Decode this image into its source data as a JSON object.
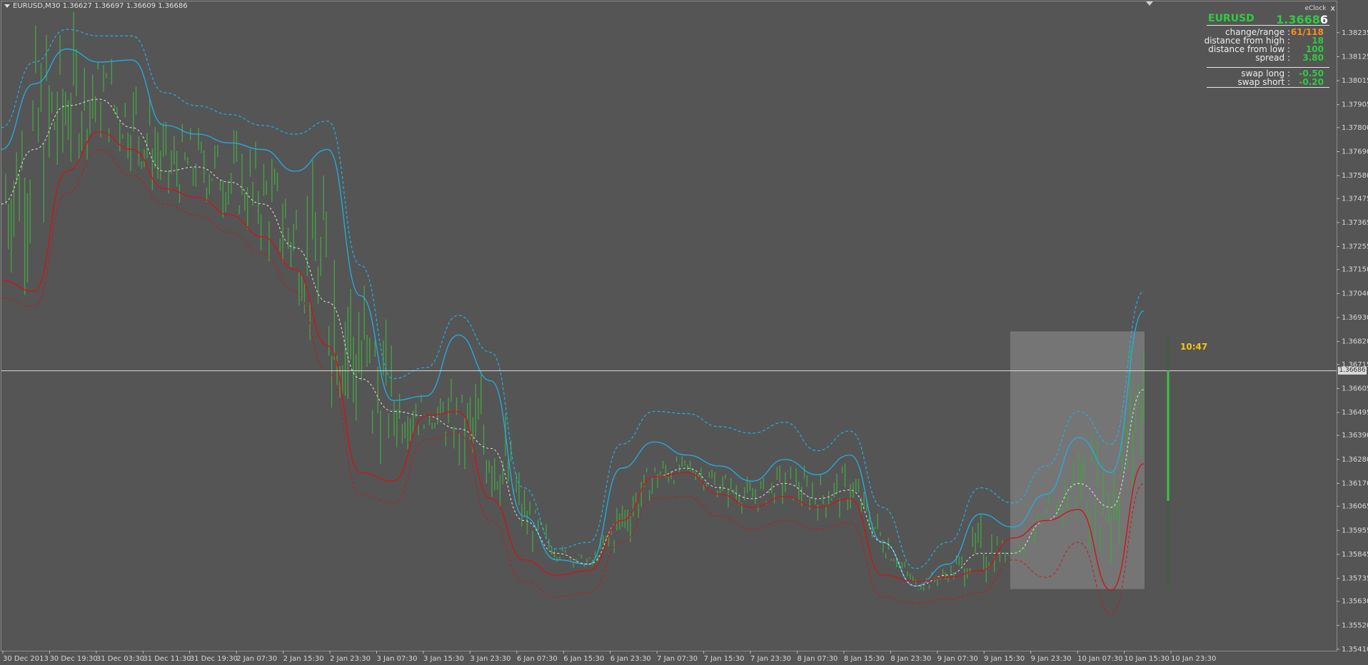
{
  "window": {
    "symbol_info": "EURUSD,M30  1.36627 1.36697 1.36609 1.36686"
  },
  "eclock": {
    "title": "eClock",
    "close": "x",
    "symbol": "EURUSD",
    "price_main": "1.3668",
    "price_last_digit": "6",
    "rows_top": [
      {
        "label": "change/range :",
        "value": "61/118",
        "color": "#ff8c1a"
      },
      {
        "label": "distance from high :",
        "value": "18",
        "color": "#2ecc40"
      },
      {
        "label": "distance from low :",
        "value": "100",
        "color": "#2ecc40"
      },
      {
        "label": "spread :",
        "value": "3.80",
        "color": "#2ecc40"
      }
    ],
    "rows_bottom": [
      {
        "label": "swap long :",
        "value": "-0.50",
        "color": "#2ecc40"
      },
      {
        "label": "swap short :",
        "value": "-0.20",
        "color": "#2ecc40"
      }
    ]
  },
  "timer": "10:47",
  "current_price_tag": "1.36686",
  "colors": {
    "background": "#555555",
    "candle": "#46a046",
    "upper_band": "#1fb0e6",
    "lower_band": "#c8171b",
    "mid_line": "#e6e6e6",
    "session_box": "#777777",
    "price_line": "#d9d9d9"
  },
  "chart_data": {
    "type": "line",
    "symbol": "EURUSD",
    "timeframe": "M30",
    "ohlc_last": {
      "open": 1.36627,
      "high": 1.36697,
      "low": 1.36609,
      "close": 1.36686
    },
    "ylim": [
      1.3541,
      1.3828
    ],
    "y_ticks": [
      "1.38235",
      "1.38125",
      "1.38015",
      "1.37905",
      "1.37800",
      "1.37690",
      "1.37580",
      "1.37475",
      "1.37365",
      "1.37255",
      "1.37150",
      "1.37040",
      "1.36930",
      "1.36820",
      "1.36715",
      "1.36605",
      "1.36495",
      "1.36390",
      "1.36280",
      "1.36170",
      "1.36065",
      "1.35955",
      "1.35845",
      "1.35735",
      "1.35630",
      "1.35520",
      "1.35410"
    ],
    "x_ticks": [
      "30 Dec 2013",
      "30 Dec 19:30",
      "31 Dec 03:30",
      "31 Dec 11:30",
      "31 Dec 19:30",
      "2 Jan 07:30",
      "2 Jan 15:30",
      "2 Jan 23:30",
      "3 Jan 07:30",
      "3 Jan 15:30",
      "3 Jan 23:30",
      "6 Jan 07:30",
      "6 Jan 15:30",
      "6 Jan 23:30",
      "7 Jan 07:30",
      "7 Jan 15:30",
      "7 Jan 23:30",
      "8 Jan 07:30",
      "8 Jan 15:30",
      "8 Jan 23:30",
      "9 Jan 07:30",
      "9 Jan 15:30",
      "9 Jan 23:30",
      "10 Jan 07:30",
      "10 Jan 15:30",
      "10 Jan 23:30"
    ],
    "current_price": 1.36686,
    "series": [
      {
        "key": "upper_dashed",
        "style": "dashed",
        "values": [
          1.378,
          1.381,
          1.3825,
          1.3822,
          1.3822,
          1.3796,
          1.379,
          1.3786,
          1.3781,
          1.3777,
          1.3783,
          1.3717,
          1.3665,
          1.367,
          1.3694,
          1.3677,
          1.3615,
          1.3587,
          1.359,
          1.3635,
          1.365,
          1.3649,
          1.3643,
          1.364,
          1.3645,
          1.3632,
          1.3641,
          1.3606,
          1.3578,
          1.359,
          1.3615,
          1.3608,
          1.3625,
          1.365,
          1.3635,
          1.3705
        ]
      },
      {
        "key": "upper_solid",
        "style": "solid",
        "values": [
          1.377,
          1.38,
          1.3816,
          1.381,
          1.3811,
          1.3781,
          1.3777,
          1.3773,
          1.377,
          1.376,
          1.377,
          1.3703,
          1.3655,
          1.3657,
          1.3685,
          1.3664,
          1.3602,
          1.3582,
          1.358,
          1.3624,
          1.3636,
          1.363,
          1.3625,
          1.3618,
          1.3628,
          1.3621,
          1.363,
          1.359,
          1.357,
          1.358,
          1.3603,
          1.3597,
          1.3612,
          1.3638,
          1.3622,
          1.3696
        ]
      },
      {
        "key": "mid",
        "style": "dashed",
        "values": [
          1.3745,
          1.377,
          1.379,
          1.3793,
          1.378,
          1.376,
          1.3762,
          1.3755,
          1.3745,
          1.3725,
          1.37,
          1.3665,
          1.365,
          1.3648,
          1.3642,
          1.3633,
          1.36,
          1.3585,
          1.358,
          1.36,
          1.362,
          1.3624,
          1.3615,
          1.361,
          1.3617,
          1.361,
          1.3614,
          1.359,
          1.357,
          1.3575,
          1.3585,
          1.3585,
          1.36,
          1.3617,
          1.3606,
          1.366
        ]
      },
      {
        "key": "lower_solid",
        "style": "solid",
        "values": [
          1.371,
          1.3705,
          1.376,
          1.3778,
          1.377,
          1.3752,
          1.3748,
          1.374,
          1.373,
          1.3715,
          1.368,
          1.3622,
          1.3618,
          1.3648,
          1.365,
          1.361,
          1.3582,
          1.3575,
          1.3577,
          1.36,
          1.362,
          1.3622,
          1.3612,
          1.3606,
          1.3611,
          1.3606,
          1.361,
          1.3575,
          1.3572,
          1.3574,
          1.3577,
          1.3592,
          1.36,
          1.3605,
          1.3568,
          1.3626
        ]
      },
      {
        "key": "lower_dashed",
        "style": "dashed",
        "values": [
          1.3702,
          1.3698,
          1.375,
          1.377,
          1.3758,
          1.3745,
          1.374,
          1.3732,
          1.3722,
          1.3705,
          1.3668,
          1.3612,
          1.3608,
          1.3637,
          1.364,
          1.36,
          1.3572,
          1.3565,
          1.3567,
          1.359,
          1.361,
          1.3611,
          1.3602,
          1.3596,
          1.36,
          1.3596,
          1.3599,
          1.3565,
          1.3562,
          1.3564,
          1.3567,
          1.3582,
          1.3574,
          1.359,
          1.3557,
          1.3617
        ]
      }
    ],
    "session_box": {
      "from": "9 Jan 23:30",
      "to": "10 Jan 23:30",
      "high": 1.36866,
      "low": 1.35686
    }
  }
}
